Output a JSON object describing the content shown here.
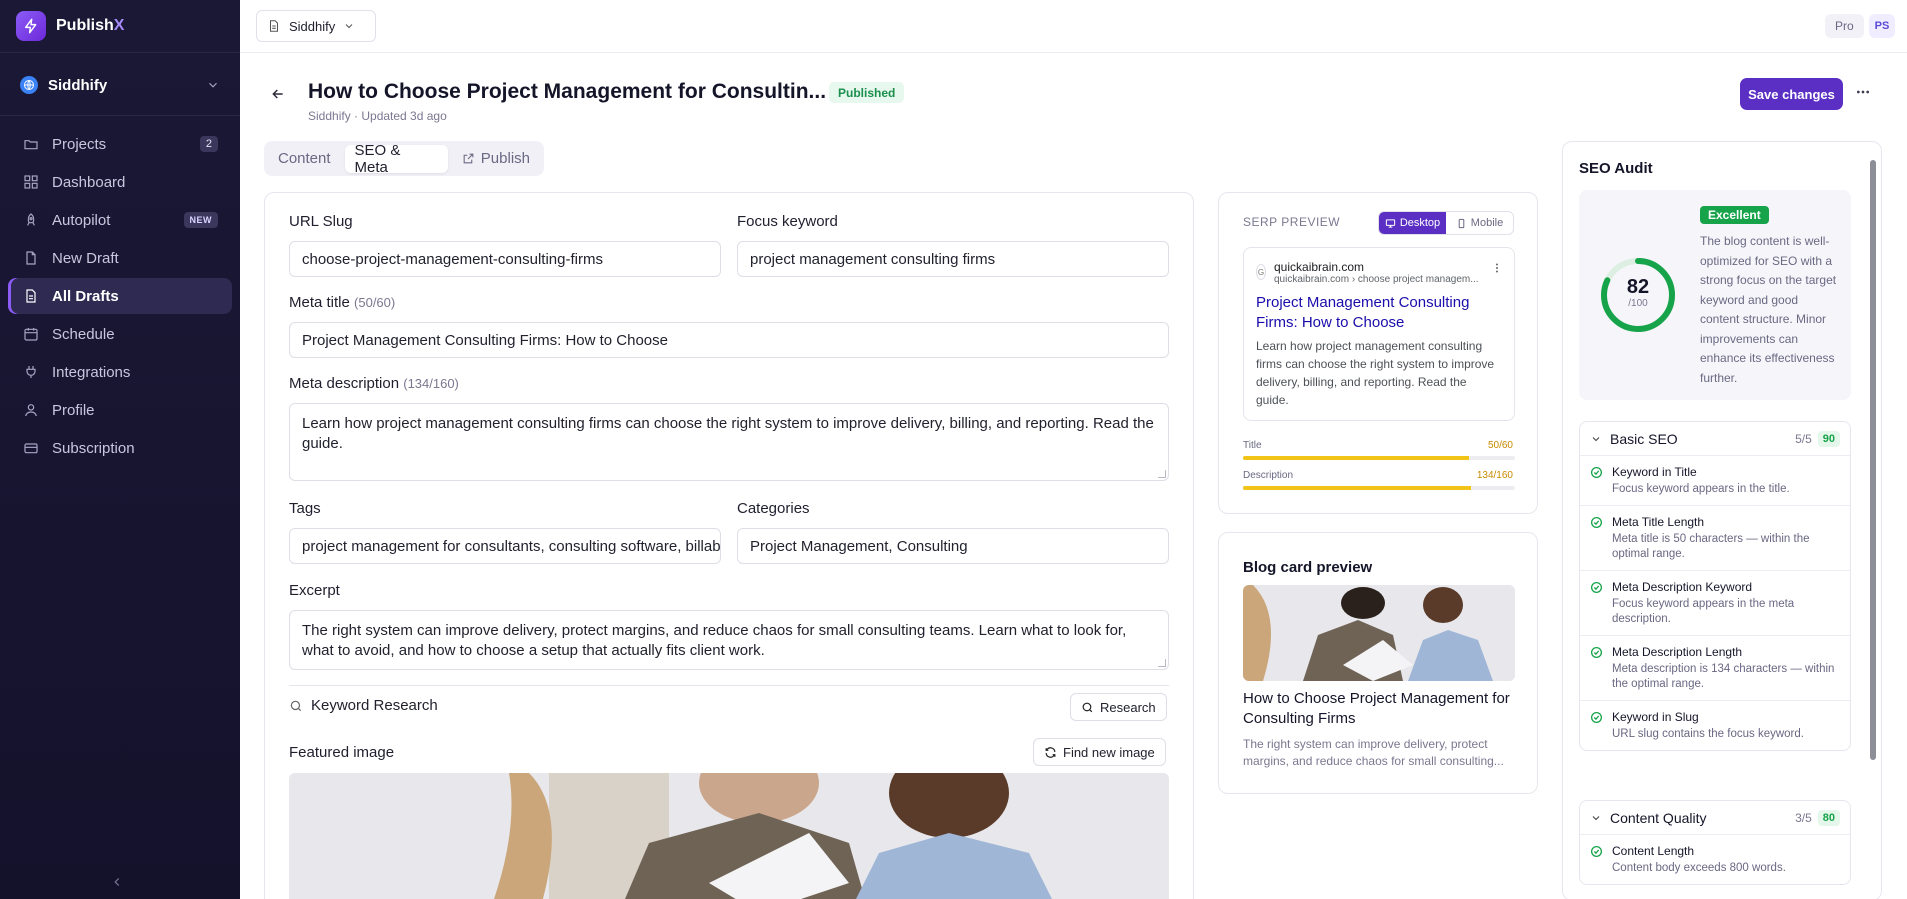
{
  "app": {
    "brand_name": "Publish",
    "brand_suffix": "X"
  },
  "sidebar": {
    "workspace": "Siddhify",
    "items": [
      {
        "label": "Projects",
        "icon": "folder-icon",
        "badge": "2"
      },
      {
        "label": "Dashboard",
        "icon": "grid-icon"
      },
      {
        "label": "Autopilot",
        "icon": "rocket-icon",
        "badge": "NEW"
      },
      {
        "label": "New Draft",
        "icon": "document-icon"
      },
      {
        "label": "All Drafts",
        "icon": "document-list-icon",
        "active": true
      },
      {
        "label": "Schedule",
        "icon": "calendar-icon"
      },
      {
        "label": "Integrations",
        "icon": "plug-icon"
      },
      {
        "label": "Profile",
        "icon": "user-icon"
      },
      {
        "label": "Subscription",
        "icon": "card-icon"
      }
    ]
  },
  "topbar": {
    "project": "Siddhify",
    "plan": "Pro",
    "avatar_initials": "PS"
  },
  "header": {
    "title": "How to Choose Project Management for Consultin...",
    "status": "Published",
    "meta": "Siddhify · Updated 3d ago",
    "save_label": "Save changes"
  },
  "tabs": [
    {
      "label": "Content"
    },
    {
      "label": "SEO & Meta",
      "active": true
    },
    {
      "label": "Publish"
    }
  ],
  "form": {
    "url_slug_label": "URL Slug",
    "url_slug": "choose-project-management-consulting-firms",
    "focus_keyword_label": "Focus keyword",
    "focus_keyword": "project management consulting firms",
    "meta_title_label": "Meta title",
    "meta_title_count": "(50/60)",
    "meta_title": "Project Management Consulting Firms: How to Choose",
    "meta_desc_label": "Meta description",
    "meta_desc_count": "(134/160)",
    "meta_desc": "Learn how project management consulting firms can choose the right system to improve delivery, billing, and reporting. Read the guide.",
    "tags_label": "Tags",
    "tags": "project management for consultants, consulting software, billable",
    "categories_label": "Categories",
    "categories": "Project Management, Consulting",
    "excerpt_label": "Excerpt",
    "excerpt": "The right system can improve delivery, protect margins, and reduce chaos for small consulting teams. Learn what to look for, what to avoid, and how to choose a setup that actually fits client work.",
    "keyword_research_label": "Keyword Research",
    "research_button": "Research",
    "featured_image_label": "Featured image",
    "find_image_button": "Find new image"
  },
  "serp": {
    "heading": "SERP PREVIEW",
    "desktop_label": "Desktop",
    "mobile_label": "Mobile",
    "favicon_letter": "G",
    "domain": "quickaibrain.com",
    "path": "quickaibrain.com › choose project managem...",
    "title": "Project Management Consulting Firms: How to Choose",
    "description": "Learn how project management consulting firms can choose the right system to improve delivery, billing, and reporting. Read the guide.",
    "title_meter_label": "Title",
    "title_meter_value": "50/60",
    "title_fill": 0.83,
    "desc_meter_label": "Description",
    "desc_meter_value": "134/160",
    "desc_fill": 0.84,
    "meter_color": "#f2c418"
  },
  "blog_card": {
    "heading": "Blog card preview",
    "title": "How to Choose Project Management for Consulting Firms",
    "excerpt": "The right system can improve delivery, protect margins, and reduce chaos for small consulting..."
  },
  "audit": {
    "title": "SEO Audit",
    "rating": "Excellent",
    "score": "82",
    "score_max": "/100",
    "score_fraction": 0.82,
    "summary": "The blog content is well-optimized for SEO with a strong focus on the target keyword and good content structure. Minor improvements can enhance its effectiveness further.",
    "sections": [
      {
        "title": "Basic SEO",
        "fraction": "5/5",
        "score": "90",
        "checks": [
          {
            "title": "Keyword in Title",
            "desc": "Focus keyword appears in the title."
          },
          {
            "title": "Meta Title Length",
            "desc": "Meta title is 50 characters — within the optimal range."
          },
          {
            "title": "Meta Description Keyword",
            "desc": "Focus keyword appears in the meta description."
          },
          {
            "title": "Meta Description Length",
            "desc": "Meta description is 134 characters — within the optimal range."
          },
          {
            "title": "Keyword in Slug",
            "desc": "URL slug contains the focus keyword."
          }
        ]
      },
      {
        "title": "Content Quality",
        "fraction": "3/5",
        "score": "80",
        "checks": [
          {
            "title": "Content Length",
            "desc": "Content body exceeds 800 words."
          }
        ]
      }
    ],
    "accent": "#16a34a"
  }
}
